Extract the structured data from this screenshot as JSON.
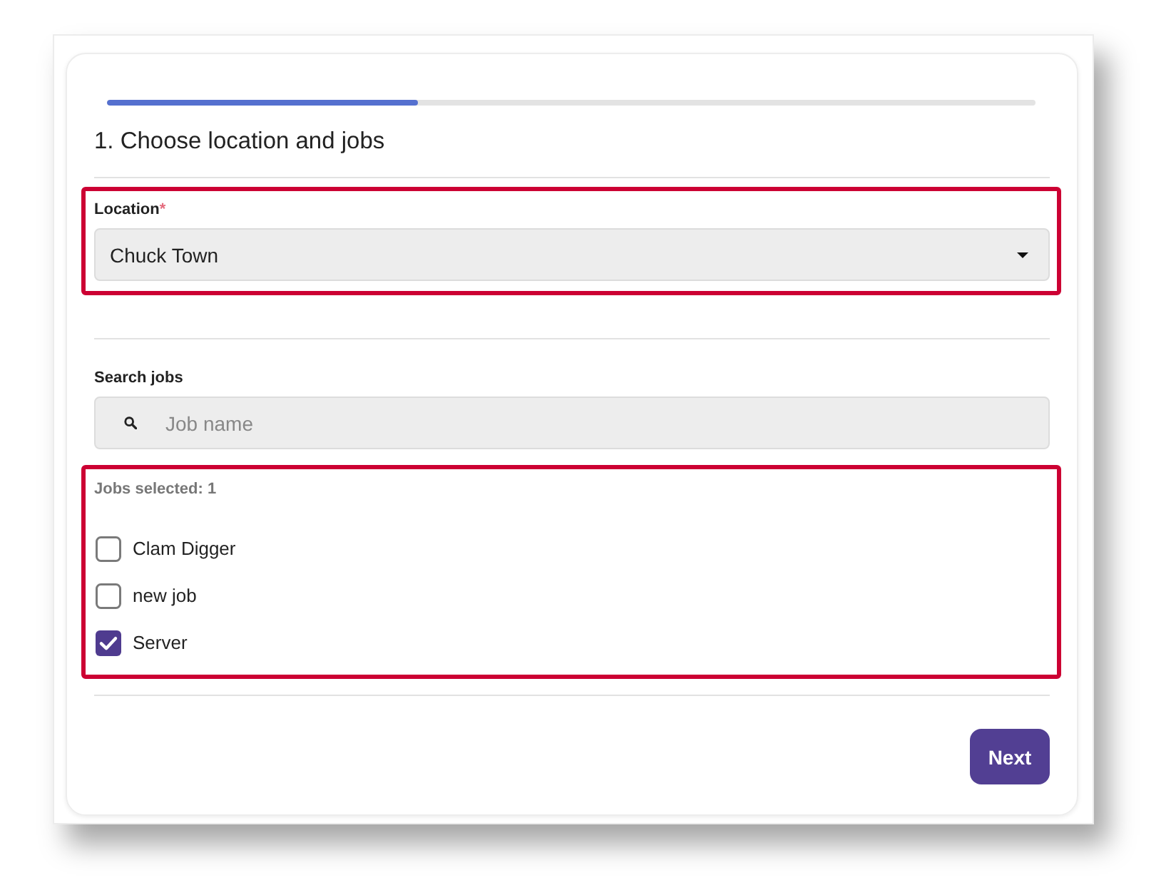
{
  "progress": {
    "level": 0.335
  },
  "title": "1. Choose location and jobs",
  "location": {
    "highlighted": true,
    "label": "Location",
    "required_mark": "*",
    "value": "Chuck Town"
  },
  "search": {
    "label": "Search jobs",
    "placeholder": "Job name"
  },
  "jobs": {
    "highlighted": true,
    "count_label": "Jobs selected: 1",
    "items": [
      {
        "label": "Clam Digger",
        "checked": false
      },
      {
        "label": "new job",
        "checked": false
      },
      {
        "label": "Server",
        "checked": true
      }
    ]
  },
  "next_button": {
    "label": "Next"
  }
}
